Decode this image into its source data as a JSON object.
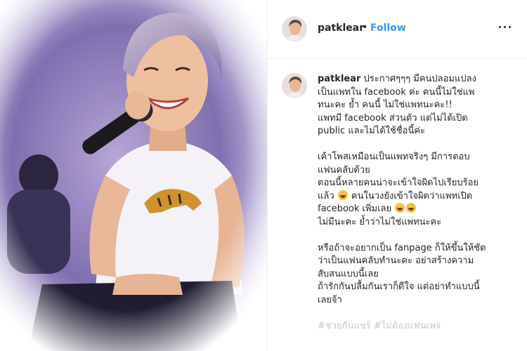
{
  "header": {
    "username": "patklear",
    "separator": "•",
    "follow_label": "Follow",
    "more_icon": "more-options-icon"
  },
  "caption": {
    "username": "patklear",
    "first_line": " ประกาศๆๆๆ มีคนปลอมแปลง",
    "lines": [
      "เป็นแพทใน facebook ค่ะ คนนี้ไม่ใช่แพ",
      "ทนะคะ ย้ำ คนนี้ ไม่ใช่แพทนะคะ!!",
      "แพทมี facebook ส่วนตัว แต่ไม่ได้เปิด",
      "public และไม่ได้ใช้ชื่อนี้ค่ะ"
    ],
    "para2": [
      "เค้าโพสเหมือนเป็นแพทจริงๆ มีการตอบ",
      "แฟนคลับด้วย",
      "ตอนนี้หลายคนน่าจะเข้าใจผิดไปเรียบร้อย"
    ],
    "para2_line4_a": "แล้ว ",
    "para2_line4_b": " คนในวงยังเข้าใจผิดว่าแพทเปิด",
    "para2_line5": "facebook เพิ่มเลย ",
    "para2_line6": "ไม่มีนะคะ ย้ำว่าไม่ใช่แพทนะคะ",
    "para3": [
      "หรือถ้าจะอยากเป็น fanpage ก็ให้ขึ้นให้ชัด",
      "ว่าเป็นแฟนคลับทำนะคะ อย่าสร้างความ",
      "สับสนแบบนี้เลย",
      "ถ้ารักกันปลื้มกันเราก็ดีใจ แต่อย่าทำแบบนี้",
      "เลยจ้า"
    ],
    "faded_line": "#ช่วยกันแชร์ #ไม่ต้องแฟนเพจ",
    "emoji_name": "grinning-sweat-emoji"
  },
  "colors": {
    "follow": "#3897f0",
    "text": "#262626",
    "border": "#efefef"
  }
}
